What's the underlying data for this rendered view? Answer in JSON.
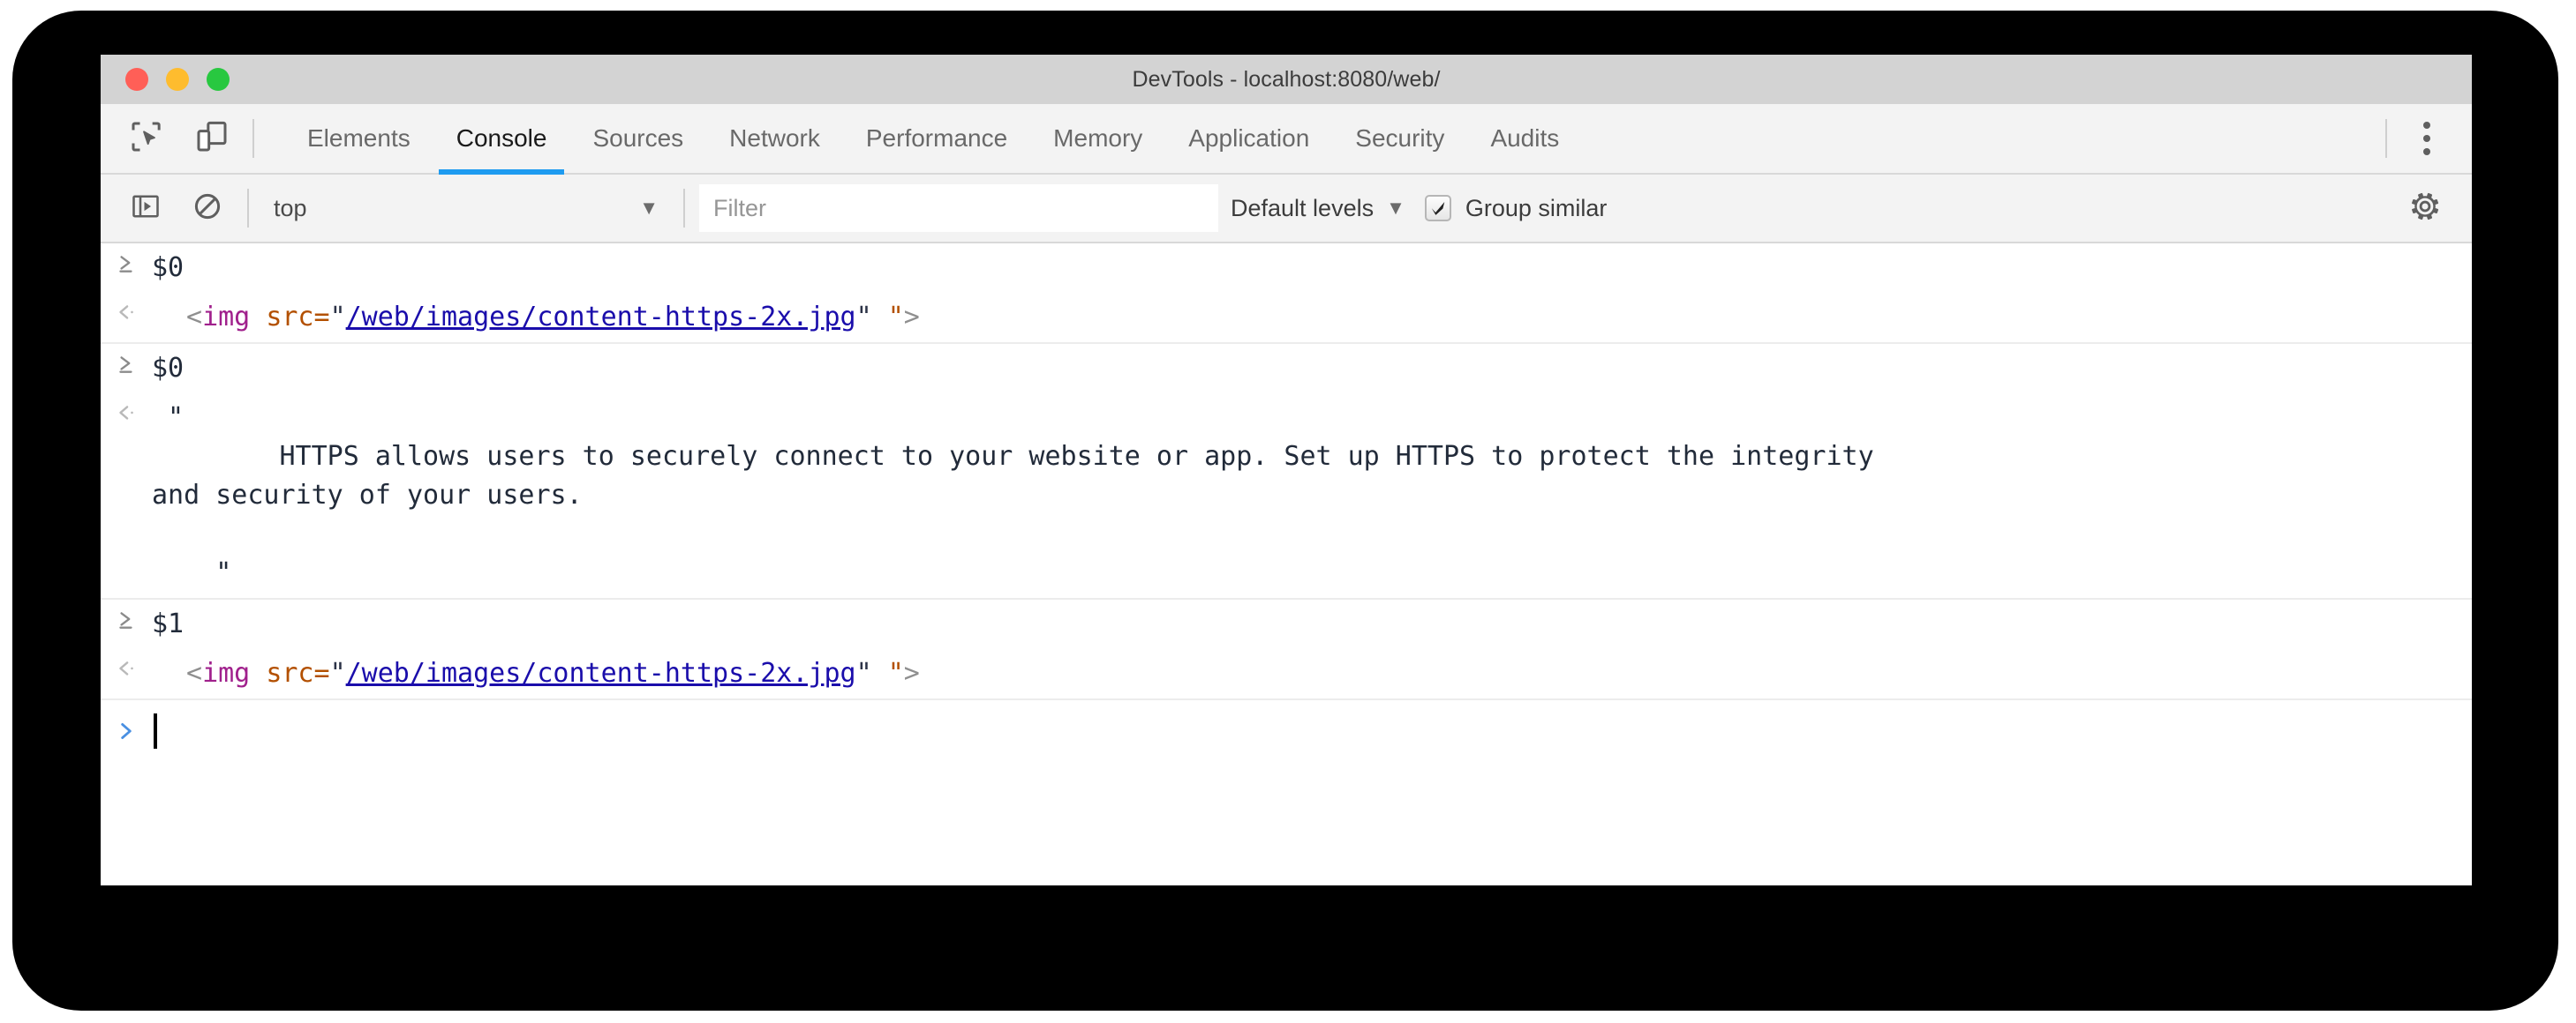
{
  "window": {
    "title": "DevTools - localhost:8080/web/",
    "traffic_lights": [
      {
        "name": "close",
        "color": "#ff5f57"
      },
      {
        "name": "minimize",
        "color": "#febc2e"
      },
      {
        "name": "zoom",
        "color": "#28c840"
      }
    ]
  },
  "tabbar": {
    "left_icons": [
      {
        "name": "inspect-element-icon"
      },
      {
        "name": "device-toolbar-icon"
      }
    ],
    "tabs": [
      {
        "label": "Elements",
        "active": false
      },
      {
        "label": "Console",
        "active": true
      },
      {
        "label": "Sources",
        "active": false
      },
      {
        "label": "Network",
        "active": false
      },
      {
        "label": "Performance",
        "active": false
      },
      {
        "label": "Memory",
        "active": false
      },
      {
        "label": "Application",
        "active": false
      },
      {
        "label": "Security",
        "active": false
      },
      {
        "label": "Audits",
        "active": false
      }
    ],
    "more_options": "more-options-icon",
    "active_underline_color": "#1e9bf0"
  },
  "toolbar": {
    "sidebar_toggle": "console-sidebar-icon",
    "clear_console": "clear-console-icon",
    "context": {
      "value": "top",
      "caret": "▼"
    },
    "filter": {
      "placeholder": "Filter",
      "value": ""
    },
    "levels": {
      "label": "Default levels",
      "caret": "▼"
    },
    "group_similar": {
      "label": "Group similar",
      "checked": true
    },
    "settings": "settings-gear-icon"
  },
  "console": {
    "groups": [
      {
        "input": "$0",
        "output_kind": "html",
        "output": {
          "lt": "<",
          "tag": "img",
          "space": " ",
          "attr": "src",
          "eq": "=",
          "open_quote": "\"",
          "url": "/web/images/content-https-2x.jpg",
          "close_quote": "\"",
          "gap": " ",
          "trailing_quote": "\"",
          "gt": ">"
        }
      },
      {
        "input": "$0",
        "output_kind": "string",
        "output": {
          "open_quote": "\"",
          "body_line_1": "        HTTPS allows users to securely connect to your website or app. Set up HTTPS to protect the integrity",
          "body_line_2": "and security of your users.",
          "blank_line": "",
          "close_quote": "    \""
        }
      },
      {
        "input": "$1",
        "output_kind": "html",
        "output": {
          "lt": "<",
          "tag": "img",
          "space": " ",
          "attr": "src",
          "eq": "=",
          "open_quote": "\"",
          "url": "/web/images/content-https-2x.jpg",
          "close_quote": "\"",
          "gap": " ",
          "trailing_quote": "\"",
          "gt": ">"
        }
      }
    ],
    "prompt": {
      "chevron": "›",
      "value": "",
      "chevron_color": "#4a90e2"
    }
  }
}
